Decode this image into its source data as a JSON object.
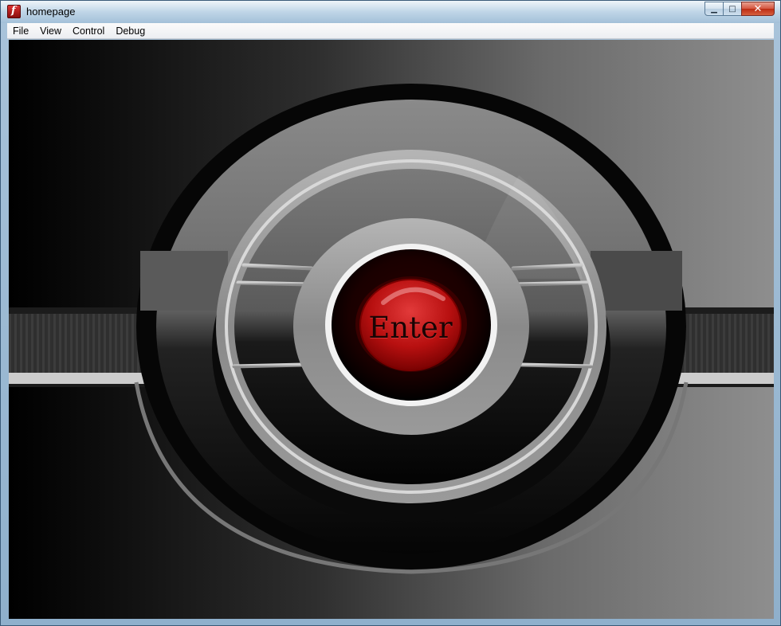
{
  "window": {
    "title": "homepage",
    "app_icon_glyph": "f",
    "controls": {
      "minimize_glyph": "▁",
      "maximize_glyph": "□",
      "close_glyph": "✕"
    }
  },
  "menubar": {
    "items": [
      "File",
      "View",
      "Control",
      "Debug"
    ]
  },
  "stage": {
    "enter_label": "Enter"
  },
  "colors": {
    "button_red": "#c41414",
    "button_dark_red": "#3a0000",
    "ring_grey": "#9a9a9a",
    "titlebar_blue": "#bcd3e6"
  },
  "icons": {
    "app_icon": "flash-player-icon",
    "minimize": "minimize-icon",
    "maximize": "maximize-icon",
    "close": "close-icon"
  }
}
